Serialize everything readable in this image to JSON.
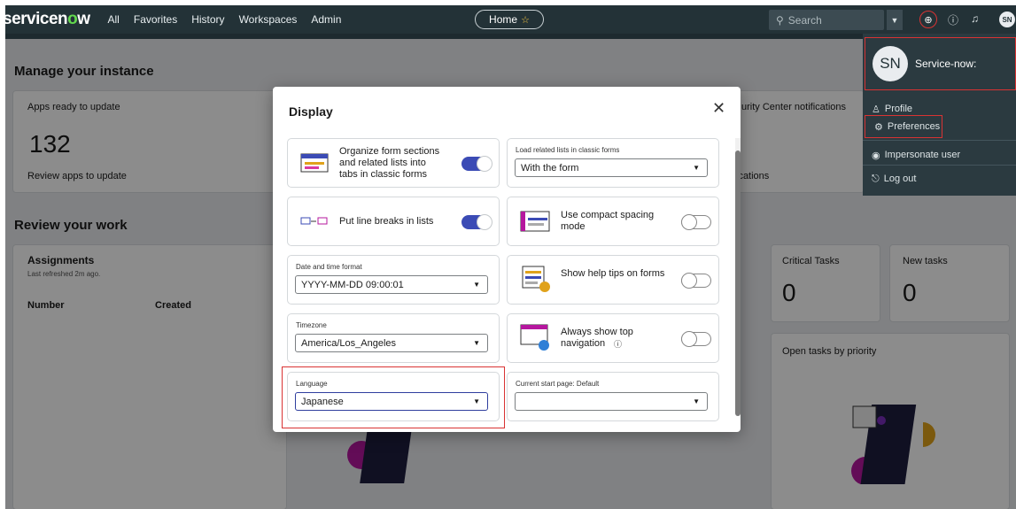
{
  "nav": {
    "logo_main": "servicen",
    "logo_accent": "o",
    "logo_end": "w",
    "links": [
      "All",
      "Favorites",
      "History",
      "Workspaces",
      "Admin"
    ],
    "home_label": "Home",
    "search_placeholder": "Search",
    "avatar_initials": "SN"
  },
  "background": {
    "manage_title": "Manage your instance",
    "apps_card_title": "Apps ready to update",
    "apps_count": "132",
    "apps_link": "Review apps to update",
    "security_title": "urity Center notifications",
    "security_link": "ications",
    "review_title": "Review your work",
    "assign_title": "Assignments",
    "assign_refreshed": "Last refreshed 2m ago.",
    "col_number": "Number",
    "col_created": "Created",
    "critical_title": "Critical Tasks",
    "critical_count": "0",
    "new_title": "New tasks",
    "new_count": "0",
    "priority_title": "Open tasks by priority"
  },
  "user_menu": {
    "initials": "SN",
    "name": "Service-now:",
    "items": [
      "Profile",
      "Preferences",
      "Impersonate user",
      "Log out"
    ]
  },
  "modal": {
    "title": "Display",
    "close": "✕",
    "tabs_text": "Organize form sections and related lists into tabs in classic forms",
    "related_label": "Load related lists in classic forms",
    "related_value": "With the form",
    "linebreaks_text": "Put line breaks in lists",
    "compact_text": "Use compact spacing mode",
    "datetime_label": "Date and time format",
    "datetime_value": "YYYY-MM-DD 09:00:01",
    "helptips_text": "Show help tips on forms",
    "timezone_label": "Timezone",
    "timezone_value": "America/Los_Angeles",
    "topnav_text": "Always show top navigation",
    "language_label": "Language",
    "language_value": "Japanese",
    "startpage_label": "Current start page: Default",
    "startpage_value": ""
  },
  "toggles": {
    "tabs_in_forms": true,
    "line_breaks": true,
    "compact_spacing": false,
    "help_tips": false,
    "show_top_nav": false
  },
  "colors": {
    "nav_bg": "#233237",
    "accent": "#62d84e",
    "toggle_on": "#3b4bb5",
    "highlight": "#d93333"
  }
}
